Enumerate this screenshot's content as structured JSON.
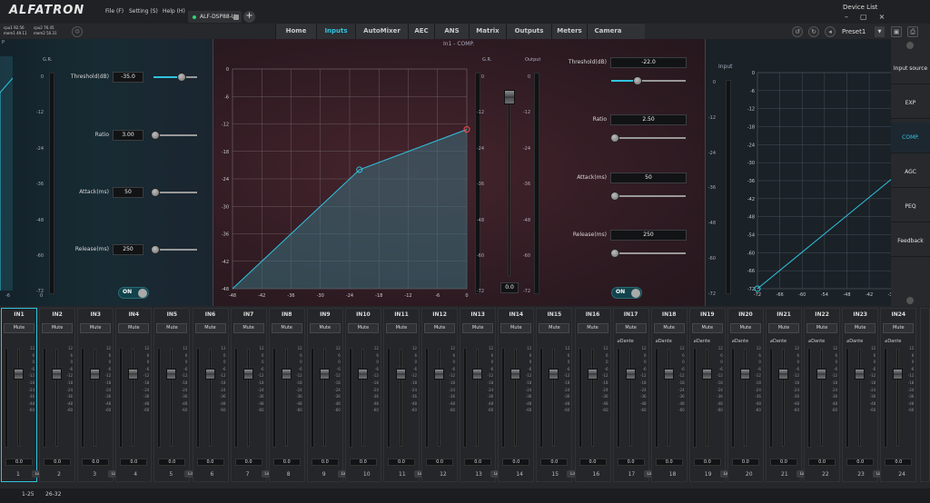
{
  "app": {
    "logo": "ALFATRON",
    "device_list": "Device List"
  },
  "menu": {
    "file": "File (F)",
    "setting": "Setting (S)",
    "help": "Help (H)"
  },
  "device_tab": {
    "label": "ALF-DSP88-U"
  },
  "stats": {
    "cpu1": "cpu1 92.56",
    "cpu2": "cpu2 76.45",
    "mem1": "mem1 49.11",
    "mem2": "mem2 50.31"
  },
  "nav": {
    "tabs": [
      "Home",
      "Inputs",
      "AutoMixer",
      "AEC",
      "ANS",
      "Matrix",
      "Outputs",
      "Meters",
      "Camera"
    ],
    "active": "Inputs"
  },
  "preset": {
    "label": "Preset1"
  },
  "side_tabs": [
    "Input source",
    "EXP",
    "COMP.",
    "AGC",
    "PEQ",
    "Feedback"
  ],
  "left_panel": {
    "gr_label": "G.R.",
    "scale": [
      "0",
      "-12",
      "-24",
      "-36",
      "-48",
      "-60",
      "-72"
    ],
    "xaxis": [
      "-6",
      "0"
    ],
    "params": [
      {
        "label": "Threshold(dB)",
        "value": "-35.0",
        "level": 0.65
      },
      {
        "label": "Ratio",
        "value": "3.00",
        "level": 0.05
      },
      {
        "label": "Attack(ms)",
        "value": "50",
        "level": 0.05
      },
      {
        "label": "Release(ms)",
        "value": "250",
        "level": 0.05
      }
    ],
    "toggle": "ON"
  },
  "center_panel": {
    "title": "In1 - COMP.",
    "graph_y": [
      "0",
      "-6",
      "-12",
      "-18",
      "-24",
      "-30",
      "-36",
      "-42",
      "-48"
    ],
    "graph_x": [
      "-48",
      "-42",
      "-36",
      "-30",
      "-24",
      "-18",
      "-12",
      "-6",
      "0"
    ],
    "gr_label": "G.R.",
    "output_label": "Output",
    "meter_scale": [
      "0",
      "-12",
      "-24",
      "-36",
      "-48",
      "-60",
      "-72"
    ],
    "gr_value": "0.0",
    "params": [
      {
        "label": "Threshold(dB)",
        "value": "-22.0",
        "level": 0.35
      },
      {
        "label": "Ratio",
        "value": "2.50",
        "level": 0.05
      },
      {
        "label": "Attack(ms)",
        "value": "50",
        "level": 0.05
      },
      {
        "label": "Release(ms)",
        "value": "250",
        "level": 0.05
      }
    ],
    "toggle": "ON"
  },
  "right_panel": {
    "input_label": "Input",
    "meter_scale": [
      "0",
      "-12",
      "-24",
      "-36",
      "-48",
      "-60",
      "-72"
    ],
    "graph_y": [
      "0",
      "-6",
      "-12",
      "-18",
      "-24",
      "-30",
      "-36",
      "-42",
      "-48",
      "-54",
      "-60",
      "-66",
      "-72"
    ],
    "graph_x": [
      "-72",
      "-66",
      "-60",
      "-54",
      "-48",
      "-42",
      "-36",
      "-2"
    ]
  },
  "fader_scale": [
    "12",
    "6",
    "0",
    "-6",
    "-12",
    "-18",
    "-24",
    "-36",
    "-48",
    "-60"
  ],
  "channels": [
    {
      "name": "IN1",
      "btn": "Mute",
      "value": "0.0",
      "num": "1",
      "link": "Link"
    },
    {
      "name": "IN2",
      "btn": "Mute",
      "value": "0.0",
      "num": "2"
    },
    {
      "name": "IN3",
      "btn": "Mute",
      "value": "0.0",
      "num": "3",
      "link": "Link"
    },
    {
      "name": "IN4",
      "btn": "Mute",
      "value": "0.0",
      "num": "4"
    },
    {
      "name": "IN5",
      "btn": "Mute",
      "value": "0.0",
      "num": "5",
      "link": "Link"
    },
    {
      "name": "IN6",
      "btn": "Mute",
      "value": "0.0",
      "num": "6"
    },
    {
      "name": "IN7",
      "btn": "Mute",
      "value": "0.0",
      "num": "7",
      "link": "Link"
    },
    {
      "name": "IN8",
      "btn": "Mute",
      "value": "0.0",
      "num": "8"
    },
    {
      "name": "IN9",
      "btn": "Mute",
      "value": "0.0",
      "num": "9",
      "link": "Link"
    },
    {
      "name": "IN10",
      "btn": "Mute",
      "value": "0.0",
      "num": "10"
    },
    {
      "name": "IN11",
      "btn": "Mute",
      "value": "0.0",
      "num": "11",
      "link": "Link"
    },
    {
      "name": "IN12",
      "btn": "Mute",
      "value": "0.0",
      "num": "12"
    },
    {
      "name": "IN13",
      "btn": "Mute",
      "value": "0.0",
      "num": "13",
      "link": "Link"
    },
    {
      "name": "IN14",
      "btn": "Mute",
      "value": "0.0",
      "num": "14"
    },
    {
      "name": "IN15",
      "btn": "Mute",
      "value": "0.0",
      "num": "15",
      "link": "Link"
    },
    {
      "name": "IN16",
      "btn": "Mute",
      "value": "0.0",
      "num": "16"
    },
    {
      "name": "IN17",
      "btn": "Mute",
      "value": "0.0",
      "num": "17",
      "link": "Link",
      "dante": "Dante"
    },
    {
      "name": "IN18",
      "btn": "Mute",
      "value": "0.0",
      "num": "18",
      "dante": "Dante"
    },
    {
      "name": "IN19",
      "btn": "Mute",
      "value": "0.0",
      "num": "19",
      "link": "Link",
      "dante": "Dante"
    },
    {
      "name": "IN20",
      "btn": "Mute",
      "value": "0.0",
      "num": "20",
      "dante": "Dante"
    },
    {
      "name": "IN21",
      "btn": "Mute",
      "value": "0.0",
      "num": "21",
      "link": "Link",
      "dante": "Dante"
    },
    {
      "name": "IN22",
      "btn": "Mute",
      "value": "0.0",
      "num": "22",
      "dante": "Dante"
    },
    {
      "name": "IN23",
      "btn": "Mute",
      "value": "0.0",
      "num": "23",
      "link": "Link",
      "dante": "Dante"
    },
    {
      "name": "IN24",
      "btn": "Mute",
      "value": "0.0",
      "num": "24",
      "dante": "Dante"
    }
  ],
  "footer": {
    "page1": "1-25",
    "page2": "26-32"
  },
  "colors": {
    "accent": "#2fc4e0",
    "threshold_point": "#ff4d4d"
  }
}
